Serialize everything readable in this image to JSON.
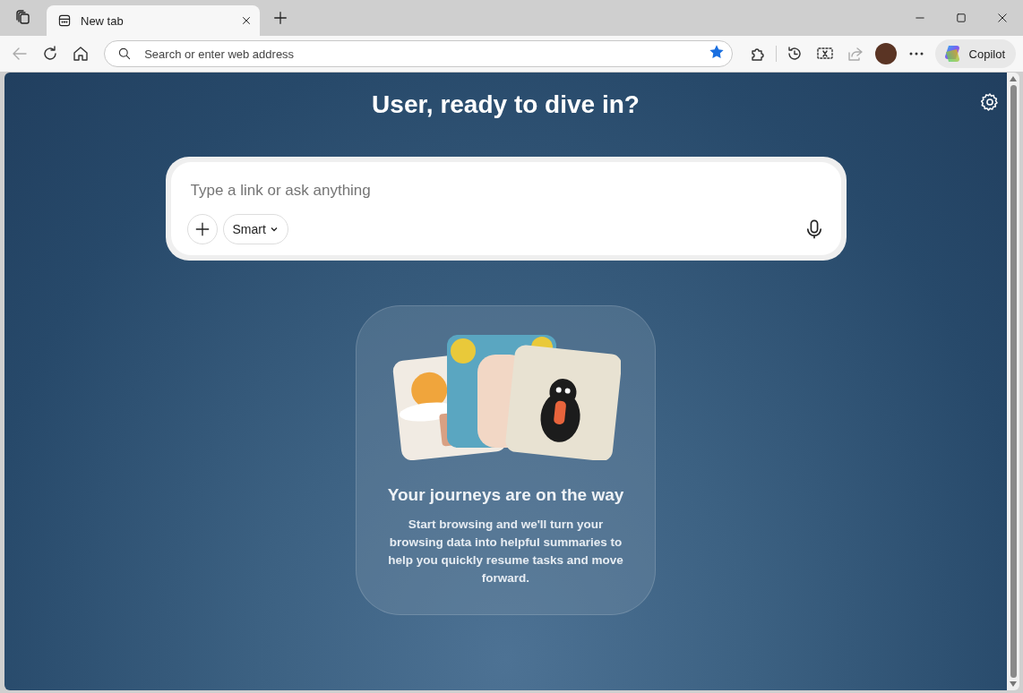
{
  "tab_strip": {
    "tabs": [
      {
        "title": "New tab",
        "selected": true
      }
    ]
  },
  "toolbar": {
    "back_disabled": true,
    "address_bar": {
      "placeholder": "Search or enter web address",
      "favorited": true
    },
    "copilot": {
      "label": "Copilot"
    }
  },
  "new_tab_page": {
    "heading": "User, ready to dive in?",
    "prompt": {
      "placeholder": "Type a link or ask anything",
      "mode": "Smart"
    },
    "journeys_card": {
      "title": "Your journeys are on the way",
      "body": "Start browsing and we'll turn your browsing data into helpful summaries to help you quickly resume tasks and move forward."
    }
  }
}
